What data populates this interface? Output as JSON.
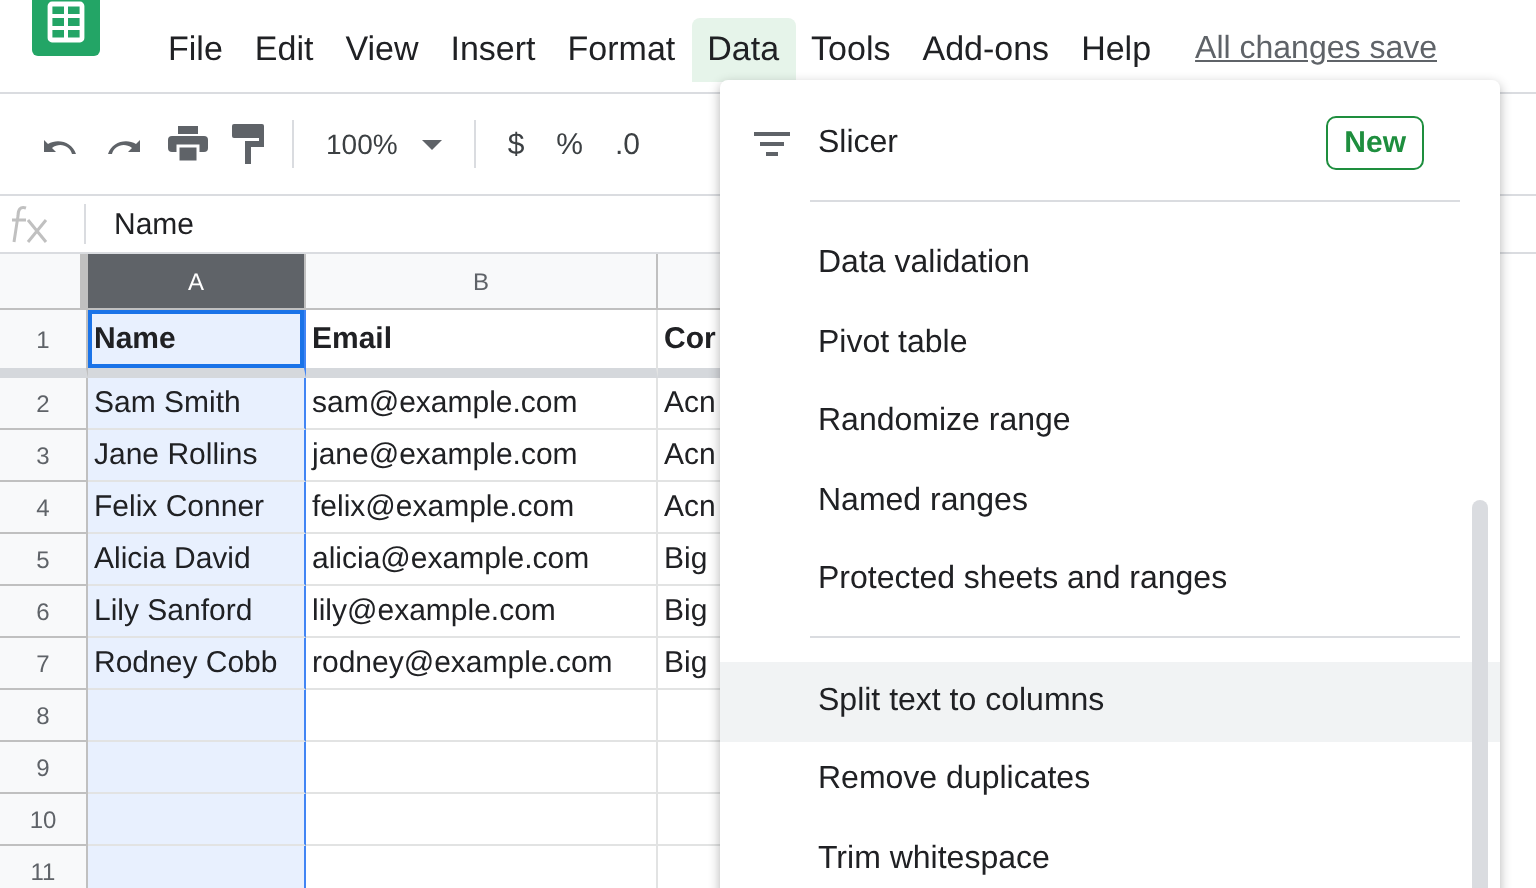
{
  "menu_bar": {
    "items": [
      {
        "label": "File",
        "selected": false
      },
      {
        "label": "Edit",
        "selected": false
      },
      {
        "label": "View",
        "selected": false
      },
      {
        "label": "Insert",
        "selected": false
      },
      {
        "label": "Format",
        "selected": false
      },
      {
        "label": "Data",
        "selected": true
      },
      {
        "label": "Tools",
        "selected": false
      },
      {
        "label": "Add-ons",
        "selected": false
      },
      {
        "label": "Help",
        "selected": false
      }
    ],
    "save_status": "All changes save"
  },
  "toolbar": {
    "zoom": "100%",
    "currency": "$",
    "percent": "%",
    "decimal": ".0"
  },
  "formula_bar": {
    "value": "Name"
  },
  "sheet": {
    "columns": [
      {
        "label": "A",
        "selected": true
      },
      {
        "label": "B",
        "selected": false
      },
      {
        "selected": false
      }
    ],
    "rows": [
      {
        "number": "1",
        "cells": [
          "Name",
          "Email",
          "Cor"
        ]
      },
      {
        "number": "2",
        "cells": [
          "Sam Smith",
          "sam@example.com",
          "Acn"
        ]
      },
      {
        "number": "3",
        "cells": [
          "Jane Rollins",
          "jane@example.com",
          "Acn"
        ]
      },
      {
        "number": "4",
        "cells": [
          "Felix Conner",
          "felix@example.com",
          "Acn"
        ]
      },
      {
        "number": "5",
        "cells": [
          "Alicia David",
          "alicia@example.com",
          "Big"
        ]
      },
      {
        "number": "6",
        "cells": [
          "Lily Sanford",
          "lily@example.com",
          "Big"
        ]
      },
      {
        "number": "7",
        "cells": [
          "Rodney Cobb",
          "rodney@example.com",
          "Big"
        ]
      },
      {
        "number": "8",
        "cells": [
          "",
          "",
          ""
        ]
      },
      {
        "number": "9",
        "cells": [
          "",
          "",
          ""
        ]
      },
      {
        "number": "10",
        "cells": [
          "",
          "",
          ""
        ]
      },
      {
        "number": "11",
        "cells": [
          "",
          "",
          ""
        ]
      }
    ]
  },
  "data_menu": {
    "items": [
      {
        "kind": "icon",
        "label": "Slicer",
        "badge": "New",
        "selected": false
      },
      {
        "kind": "separator"
      },
      {
        "kind": "plain",
        "label": "Data validation",
        "selected": false
      },
      {
        "kind": "plain",
        "label": "Pivot table",
        "selected": false
      },
      {
        "kind": "plain",
        "label": "Randomize range",
        "selected": false
      },
      {
        "kind": "plain",
        "label": "Named ranges",
        "selected": false
      },
      {
        "kind": "plain",
        "label": "Protected sheets and ranges",
        "selected": false
      },
      {
        "kind": "separator"
      },
      {
        "kind": "plain",
        "label": "Split text to columns",
        "selected": true
      },
      {
        "kind": "plain",
        "label": "Remove duplicates",
        "selected": false
      },
      {
        "kind": "plain",
        "label": "Trim whitespace",
        "selected": false
      }
    ]
  }
}
